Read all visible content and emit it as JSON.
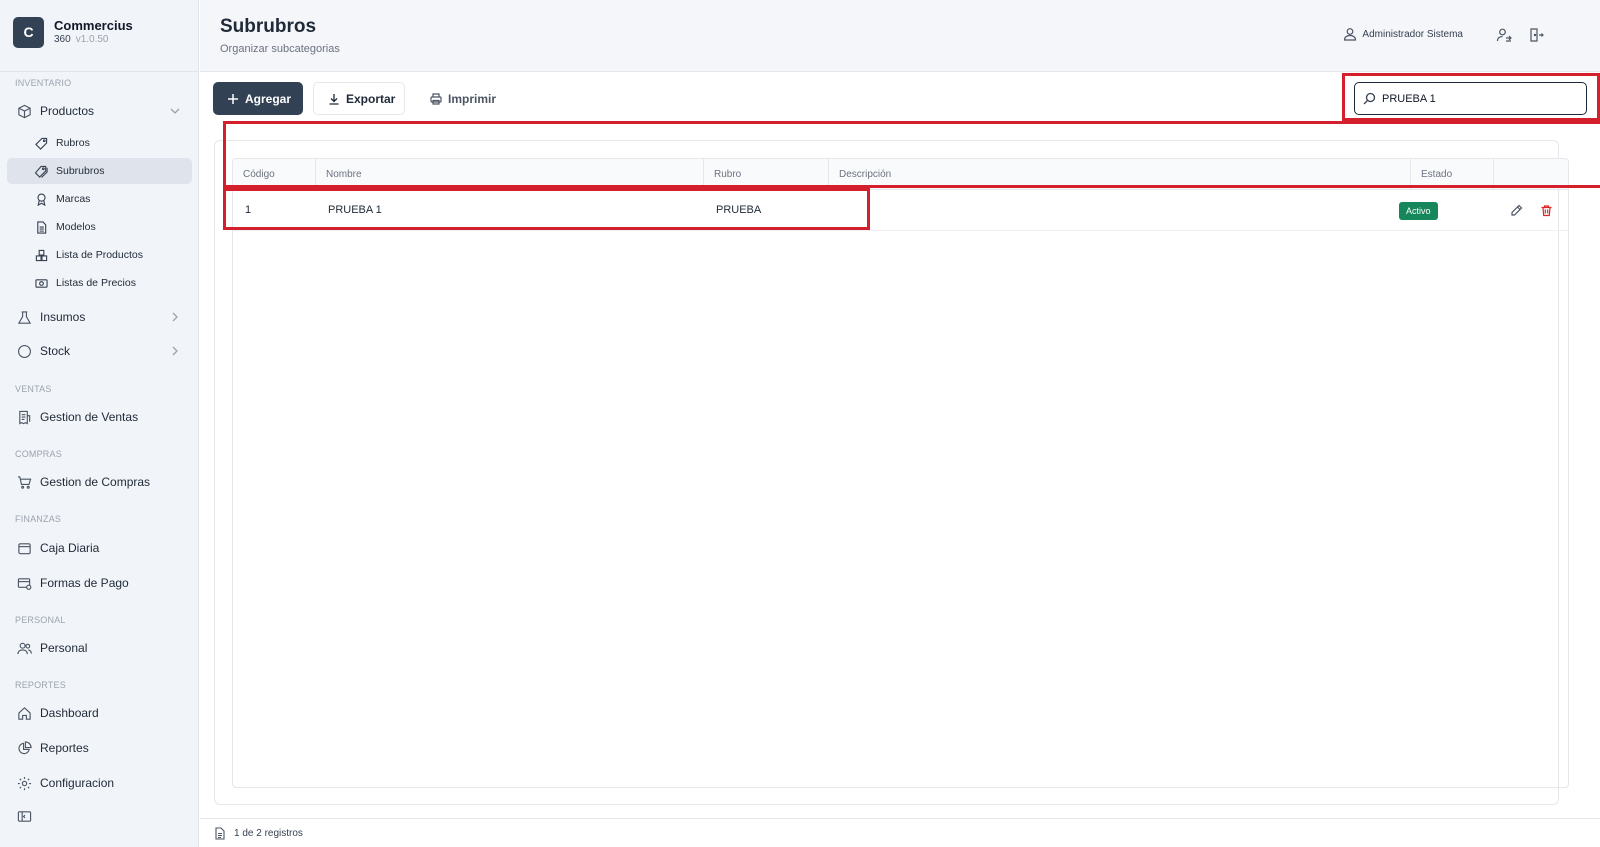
{
  "brand": {
    "logo_letter": "C",
    "name": "Commercius",
    "edition": "360",
    "version": "v1.0.50"
  },
  "sidebar": {
    "sections": {
      "inventario": "INVENTARIO",
      "ventas": "VENTAS",
      "compras": "COMPRAS",
      "finanzas": "FINANZAS",
      "personal": "PERSONAL",
      "reportes": "REPORTES"
    },
    "productos": "Productos",
    "sub": {
      "rubros": "Rubros",
      "subrubros": "Subrubros",
      "marcas": "Marcas",
      "modelos": "Modelos",
      "lista_productos": "Lista de Productos",
      "listas_precios": "Listas de Precios"
    },
    "insumos": "Insumos",
    "stock": "Stock",
    "gestion_ventas": "Gestion de Ventas",
    "gestion_compras": "Gestion de Compras",
    "caja_diaria": "Caja Diaria",
    "formas_pago": "Formas de Pago",
    "personal": "Personal",
    "dashboard": "Dashboard",
    "reportes": "Reportes",
    "configuracion": "Configuracion"
  },
  "header": {
    "title": "Subrubros",
    "subtitle": "Organizar subcategorias",
    "user": "Administrador Sistema"
  },
  "toolbar": {
    "add_label": "Agregar",
    "export_label": "Exportar",
    "print_label": "Imprimir"
  },
  "search": {
    "value": "PRUEBA 1"
  },
  "table": {
    "columns": [
      "Código",
      "Nombre",
      "Rubro",
      "Descripción",
      "Estado"
    ],
    "rows": [
      {
        "codigo": "1",
        "nombre": "PRUEBA 1",
        "rubro": "PRUEBA",
        "descripcion": "",
        "estado": "Activo"
      }
    ]
  },
  "footer": {
    "records": "1 de 2 registros"
  },
  "colors": {
    "accent": "#334155",
    "active_badge": "#16875a",
    "annotation": "#d41f2c",
    "danger": "#dc2626"
  }
}
